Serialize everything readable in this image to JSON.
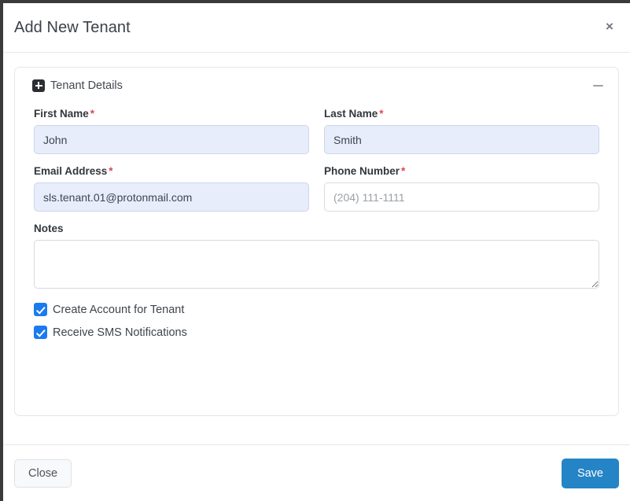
{
  "modal": {
    "title": "Add New Tenant",
    "close_icon": "×"
  },
  "section": {
    "title": "Tenant Details",
    "expand_icon": "plus-icon",
    "collapse_icon": "minus-icon"
  },
  "form": {
    "required_marker": "*",
    "fields": [
      {
        "label": "First Name",
        "required": true,
        "value": "John",
        "placeholder": "",
        "filled": true
      },
      {
        "label": "Last Name",
        "required": true,
        "value": "Smith",
        "placeholder": "",
        "filled": true
      },
      {
        "label": "Email Address",
        "required": true,
        "value": "sls.tenant.01@protonmail.com",
        "placeholder": "",
        "filled": true
      },
      {
        "label": "Phone Number",
        "required": true,
        "value": "",
        "placeholder": "(204) 111-1111",
        "filled": false
      }
    ],
    "notes": {
      "label": "Notes",
      "value": "",
      "placeholder": ""
    },
    "checkboxes": [
      {
        "label": "Create Account for Tenant",
        "checked": true
      },
      {
        "label": "Receive SMS Notifications",
        "checked": true
      }
    ]
  },
  "footer": {
    "close_label": "Close",
    "save_label": "Save"
  },
  "colors": {
    "save_button": "#2484c6",
    "checkbox": "#1a7bf0",
    "required_asterisk": "#e2435a",
    "autofill_background": "#e8edfb",
    "page_background": "#3a3a3a"
  }
}
